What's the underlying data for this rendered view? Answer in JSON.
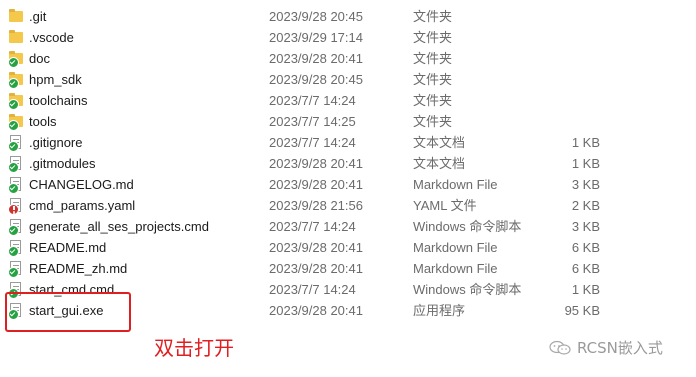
{
  "files": [
    {
      "name": ".git",
      "date": "2023/9/28 20:45",
      "type": "文件夹",
      "size": "",
      "icon": "folder-icon",
      "badge": ""
    },
    {
      "name": ".vscode",
      "date": "2023/9/29 17:14",
      "type": "文件夹",
      "size": "",
      "icon": "folder-icon",
      "badge": ""
    },
    {
      "name": "doc",
      "date": "2023/9/28 20:41",
      "type": "文件夹",
      "size": "",
      "icon": "folder-icon",
      "badge": "ok"
    },
    {
      "name": "hpm_sdk",
      "date": "2023/9/28 20:45",
      "type": "文件夹",
      "size": "",
      "icon": "folder-icon",
      "badge": "ok"
    },
    {
      "name": "toolchains",
      "date": "2023/7/7 14:24",
      "type": "文件夹",
      "size": "",
      "icon": "folder-icon",
      "badge": "ok"
    },
    {
      "name": "tools",
      "date": "2023/7/7 14:25",
      "type": "文件夹",
      "size": "",
      "icon": "folder-icon",
      "badge": "ok"
    },
    {
      "name": ".gitignore",
      "date": "2023/7/7 14:24",
      "type": "文本文档",
      "size": "1 KB",
      "icon": "document-icon",
      "badge": "ok"
    },
    {
      "name": ".gitmodules",
      "date": "2023/9/28 20:41",
      "type": "文本文档",
      "size": "1 KB",
      "icon": "document-icon",
      "badge": "ok"
    },
    {
      "name": "CHANGELOG.md",
      "date": "2023/9/28 20:41",
      "type": "Markdown File",
      "size": "3 KB",
      "icon": "document-icon",
      "badge": "ok"
    },
    {
      "name": "cmd_params.yaml",
      "date": "2023/9/28 21:56",
      "type": "YAML 文件",
      "size": "2 KB",
      "icon": "document-icon",
      "badge": "err"
    },
    {
      "name": "generate_all_ses_projects.cmd",
      "date": "2023/7/7 14:24",
      "type": "Windows 命令脚本",
      "size": "3 KB",
      "icon": "document-icon",
      "badge": "ok"
    },
    {
      "name": "README.md",
      "date": "2023/9/28 20:41",
      "type": "Markdown File",
      "size": "6 KB",
      "icon": "document-icon",
      "badge": "ok"
    },
    {
      "name": "README_zh.md",
      "date": "2023/9/28 20:41",
      "type": "Markdown File",
      "size": "6 KB",
      "icon": "document-icon",
      "badge": "ok"
    },
    {
      "name": "start_cmd.cmd",
      "date": "2023/7/7 14:24",
      "type": "Windows 命令脚本",
      "size": "1 KB",
      "icon": "document-icon",
      "badge": "ok"
    },
    {
      "name": "start_gui.exe",
      "date": "2023/9/28 20:41",
      "type": "应用程序",
      "size": "95 KB",
      "icon": "document-icon",
      "badge": "ok"
    }
  ],
  "annotation": {
    "text": "双击打开",
    "color": "#e02020"
  },
  "watermark": {
    "text": "RCSN嵌入式",
    "icon": "wechat-icon"
  },
  "colors": {
    "folder": "#f4c84a",
    "ok_badge": "#27a243",
    "err_badge": "#d0312d",
    "muted_text": "#6b6b6b"
  }
}
